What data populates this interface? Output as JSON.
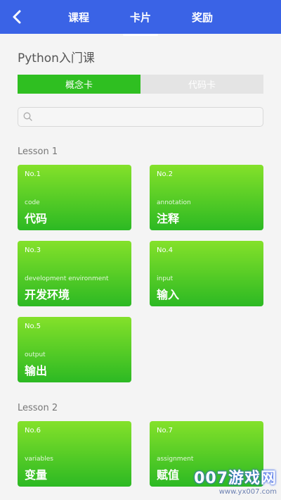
{
  "header": {
    "tabs": [
      {
        "label": "课程"
      },
      {
        "label": "卡片",
        "active": true
      },
      {
        "label": "奖励"
      }
    ]
  },
  "course": {
    "title": "Python入门课"
  },
  "segment": {
    "concept_label": "概念卡",
    "code_label": "代码卡"
  },
  "search": {
    "placeholder": ""
  },
  "lessons": [
    {
      "label": "Lesson 1",
      "cards": [
        {
          "no": "No.1",
          "en": "code",
          "cn": "代码"
        },
        {
          "no": "No.2",
          "en": "annotation",
          "cn": "注释"
        },
        {
          "no": "No.3",
          "en": "development environment",
          "cn": "开发环境"
        },
        {
          "no": "No.4",
          "en": "input",
          "cn": "输入"
        },
        {
          "no": "No.5",
          "en": "output",
          "cn": "输出"
        }
      ]
    },
    {
      "label": "Lesson 2",
      "cards": [
        {
          "no": "No.6",
          "en": "variables",
          "cn": "变量"
        },
        {
          "no": "No.7",
          "en": "assignment",
          "cn": "赋值"
        }
      ]
    }
  ],
  "watermark": {
    "main": "007游戏网",
    "url": "www.yx007.com"
  },
  "colors": {
    "header": "#3a63e6",
    "accent": "#2fbf21",
    "card_top": "#84e12a",
    "card_bottom": "#2cb923"
  }
}
